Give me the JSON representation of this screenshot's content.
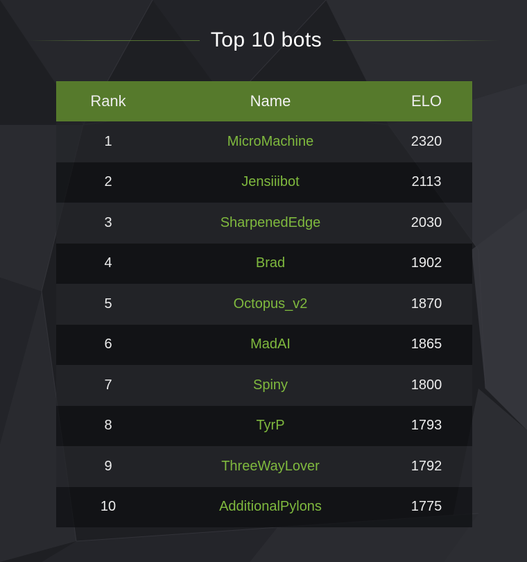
{
  "page": {
    "title": "Top 10 bots",
    "columns": {
      "rank": "Rank",
      "name": "Name",
      "elo": "ELO"
    },
    "rows": [
      {
        "rank": "1",
        "name": "MicroMachine",
        "elo": "2320"
      },
      {
        "rank": "2",
        "name": "Jensiiibot",
        "elo": "2113"
      },
      {
        "rank": "3",
        "name": "SharpenedEdge",
        "elo": "2030"
      },
      {
        "rank": "4",
        "name": "Brad",
        "elo": "1902"
      },
      {
        "rank": "5",
        "name": "Octopus_v2",
        "elo": "1870"
      },
      {
        "rank": "6",
        "name": "MadAI",
        "elo": "1865"
      },
      {
        "rank": "7",
        "name": "Spiny",
        "elo": "1800"
      },
      {
        "rank": "8",
        "name": "TyrP",
        "elo": "1793"
      },
      {
        "rank": "9",
        "name": "ThreeWayLover",
        "elo": "1792"
      },
      {
        "rank": "10",
        "name": "AdditionalPylons",
        "elo": "1775"
      }
    ]
  },
  "colors": {
    "accent": "#567a2c",
    "name_link": "#7fb93e",
    "background": "#1e1f23"
  }
}
